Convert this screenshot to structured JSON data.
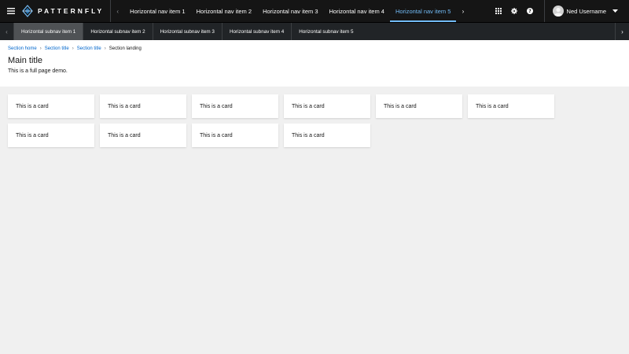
{
  "brand": {
    "name": "PATTERNFLY"
  },
  "header": {
    "nav_items": [
      {
        "label": "Horizontal nav item 1",
        "active": false
      },
      {
        "label": "Horizontal nav item 2",
        "active": false
      },
      {
        "label": "Horizontal nav item 3",
        "active": false
      },
      {
        "label": "Horizontal nav item 4",
        "active": false
      },
      {
        "label": "Horizontal nav item 5",
        "active": true
      }
    ],
    "user_name": "Ned Username"
  },
  "subnav": {
    "items": [
      {
        "label": "Horizontal subnav item 1",
        "active": true
      },
      {
        "label": "Horizontal subnav item 2",
        "active": false
      },
      {
        "label": "Horizontal subnav item 3",
        "active": false
      },
      {
        "label": "Horizontal subnav item 4",
        "active": false
      },
      {
        "label": "Horizontal subnav item 5",
        "active": false
      }
    ]
  },
  "breadcrumb": {
    "items": [
      "Section home",
      "Section title",
      "Section title"
    ],
    "current": "Section landing"
  },
  "page": {
    "title": "Main title",
    "description": "This is a full page demo."
  },
  "cards": [
    "This is a card",
    "This is a card",
    "This is a card",
    "This is a card",
    "This is a card",
    "This is a card",
    "This is a card",
    "This is a card",
    "This is a card",
    "This is a card"
  ],
  "colors": {
    "masthead_bg": "#151515",
    "subnav_bg": "#212427",
    "active_link": "#73bcf7",
    "link": "#0066cc",
    "page_bg": "#f0f0f0"
  }
}
